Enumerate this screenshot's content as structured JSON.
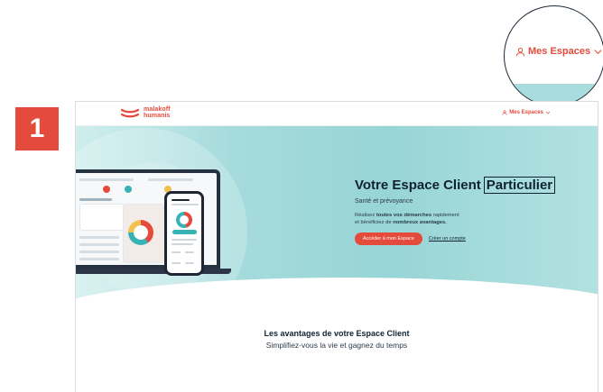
{
  "step": {
    "number": "1"
  },
  "zoom": {
    "label": "Mes Espaces"
  },
  "header": {
    "logo_line1": "malakoff",
    "logo_line2": "humanis",
    "espaces_label": "Mes Espaces"
  },
  "hero": {
    "title_prefix": "Votre Espace Client",
    "title_boxed": "Particulier",
    "subtitle": "Santé et prévoyance",
    "desc_part1": "Réalisez ",
    "desc_bold1": "toutes vos démarches",
    "desc_part2": " rapidement",
    "desc_part3": "et bénéficiez de ",
    "desc_bold2": "nombreux avantages.",
    "cta_label": "Accéder à mon Espace",
    "create_label": "Créer un compte"
  },
  "advantages": {
    "title": "Les avantages de votre Espace Client",
    "subtitle": "Simplifiez-vous la vie et gagnez du temps"
  },
  "colors": {
    "brand_red": "#e54b3c",
    "teal": "#98d5d6",
    "navy": "#0f2233"
  }
}
